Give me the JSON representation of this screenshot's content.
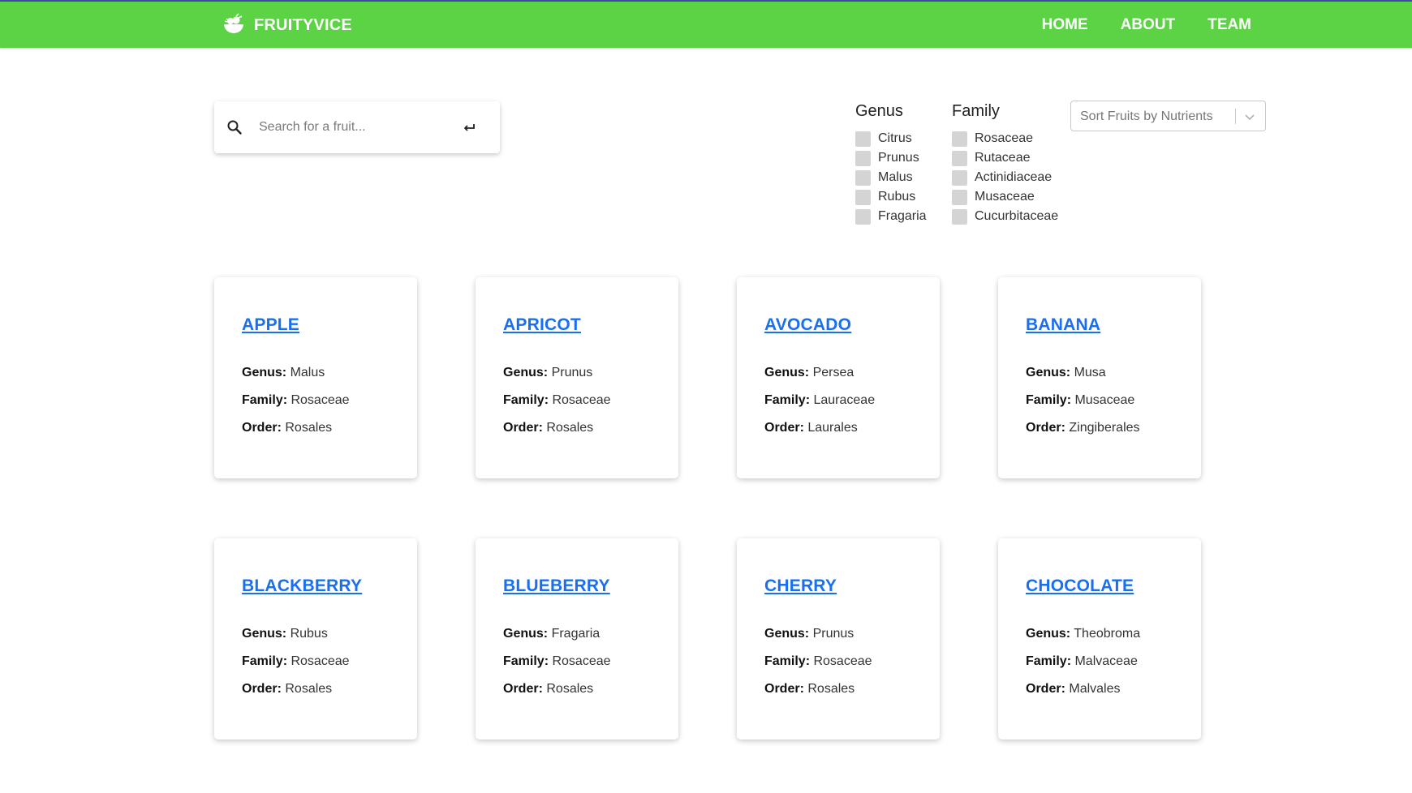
{
  "header": {
    "brand": "FRUITYVICE",
    "nav": [
      "HOME",
      "ABOUT",
      "TEAM"
    ]
  },
  "search": {
    "placeholder": "Search for a fruit..."
  },
  "filters": {
    "genus": {
      "title": "Genus",
      "options": [
        "Citrus",
        "Prunus",
        "Malus",
        "Rubus",
        "Fragaria"
      ]
    },
    "family": {
      "title": "Family",
      "options": [
        "Rosaceae",
        "Rutaceae",
        "Actinidiaceae",
        "Musaceae",
        "Cucurbitaceae"
      ]
    }
  },
  "sort": {
    "placeholder": "Sort Fruits by Nutrients"
  },
  "labels": {
    "genus": "Genus:",
    "family": "Family:",
    "order": "Order:"
  },
  "fruits": [
    {
      "name": "APPLE",
      "genus": "Malus",
      "family": "Rosaceae",
      "order": "Rosales"
    },
    {
      "name": "APRICOT",
      "genus": "Prunus",
      "family": "Rosaceae",
      "order": "Rosales"
    },
    {
      "name": "AVOCADO",
      "genus": "Persea",
      "family": "Lauraceae",
      "order": "Laurales"
    },
    {
      "name": "BANANA",
      "genus": "Musa",
      "family": "Musaceae",
      "order": "Zingiberales"
    },
    {
      "name": "BLACKBERRY",
      "genus": "Rubus",
      "family": "Rosaceae",
      "order": "Rosales"
    },
    {
      "name": "BLUEBERRY",
      "genus": "Fragaria",
      "family": "Rosaceae",
      "order": "Rosales"
    },
    {
      "name": "CHERRY",
      "genus": "Prunus",
      "family": "Rosaceae",
      "order": "Rosales"
    },
    {
      "name": "CHOCOLATE",
      "genus": "Theobroma",
      "family": "Malvaceae",
      "order": "Malvales"
    }
  ],
  "colors": {
    "header_bg": "#5bd344",
    "link": "#1a6ff0"
  }
}
